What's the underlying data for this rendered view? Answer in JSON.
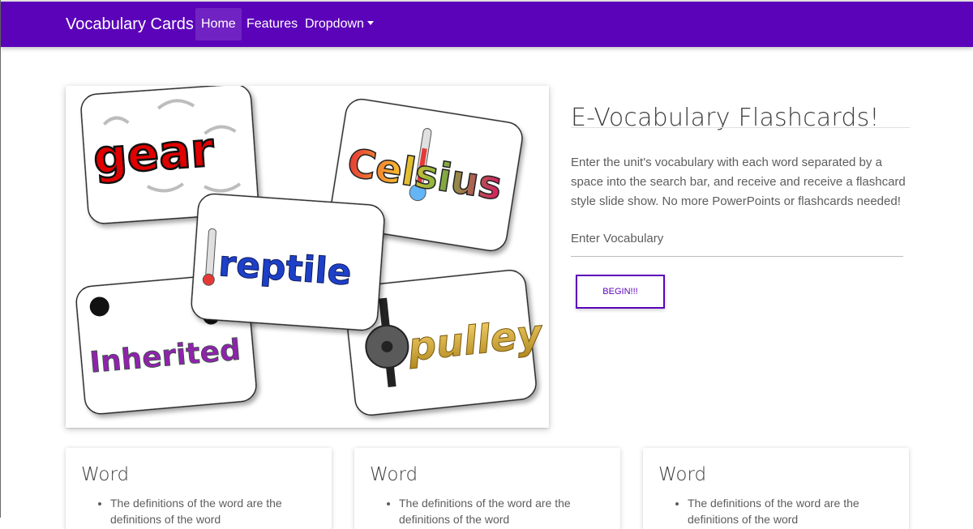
{
  "navbar": {
    "brand": "Vocabulary Cards",
    "links": [
      {
        "label": "Home"
      },
      {
        "label": "Features"
      },
      {
        "label": "Dropdown"
      }
    ],
    "color": "#5b03b9"
  },
  "hero": {
    "words": [
      "gear",
      "Celsius",
      "reptile",
      "Inherited",
      "pulley"
    ]
  },
  "main": {
    "title": "E-Vocabulary Flashcards!",
    "description": "Enter the unit's vocabulary with each word separated by a space into the search bar, and receive and receive a flashcard style slide show. No more PowerPoints or flashcards needed!",
    "input_placeholder": "Enter Vocabulary",
    "button_label": "BEGIN!!!"
  },
  "cards": [
    {
      "title": "Word",
      "definition": "The definitions of the word are the definitions of the word"
    },
    {
      "title": "Word",
      "definition": "The definitions of the word are the definitions of the word"
    },
    {
      "title": "Word",
      "definition": "The definitions of the word are the definitions of the word"
    }
  ]
}
